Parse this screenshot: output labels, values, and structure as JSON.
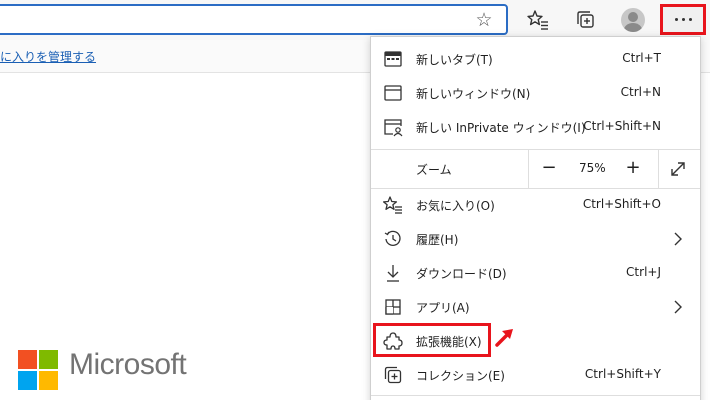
{
  "favorites_bar": {
    "manage_link": "に入りを管理する"
  },
  "menu": {
    "new_tab": {
      "label": "新しいタブ(T)",
      "shortcut": "Ctrl+T"
    },
    "new_window": {
      "label": "新しいウィンドウ(N)",
      "shortcut": "Ctrl+N"
    },
    "new_inprivate": {
      "label": "新しい InPrivate ウィンドウ(I)",
      "shortcut": "Ctrl+Shift+N"
    },
    "zoom": {
      "label": "ズーム",
      "minus": "−",
      "value": "75%",
      "plus": "+"
    },
    "favorites": {
      "label": "お気に入り(O)",
      "shortcut": "Ctrl+Shift+O"
    },
    "history": {
      "label": "履歴(H)"
    },
    "downloads": {
      "label": "ダウンロード(D)",
      "shortcut": "Ctrl+J"
    },
    "apps": {
      "label": "アプリ(A)"
    },
    "extensions": {
      "label": "拡張機能(X)"
    },
    "collections": {
      "label": "コレクション(E)",
      "shortcut": "Ctrl+Shift+Y"
    }
  },
  "logo": {
    "wordmark": "Microsoft"
  },
  "colors": {
    "highlight_red": "#e8141c",
    "address_border": "#2b6cc4",
    "ms_red": "#f25022",
    "ms_green": "#7fba00",
    "ms_blue": "#00a4ef",
    "ms_yellow": "#ffb900"
  },
  "icons": {
    "address_favorite": "star-outline-icon",
    "favorites_toolbar": "favorites-star-list-icon",
    "collections_toolbar": "collections-icon",
    "profile": "profile-avatar-icon",
    "more": "ellipsis-icon"
  }
}
